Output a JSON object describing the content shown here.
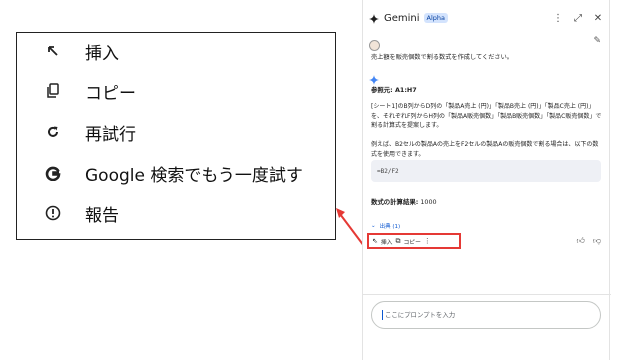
{
  "callout_menu": {
    "items": [
      {
        "icon": "insert-arrow-icon",
        "label": "挿入"
      },
      {
        "icon": "copy-icon",
        "label": "コピー"
      },
      {
        "icon": "retry-icon",
        "label": "再試行"
      },
      {
        "icon": "google-g-icon",
        "label": "Google  検索でもう一度試す"
      },
      {
        "icon": "report-icon",
        "label": "報告"
      }
    ]
  },
  "panel": {
    "brand": "Gemini",
    "badge": "Alpha",
    "prompt": "売上額を販売個数で割る数式を作成してください。",
    "reference": "参照元: A1:H7",
    "paragraph1": "[シート1]のB列からD列の「製品A売上 (円)」「製品B売上 (円)」「製品C売上 (円)」を、それぞれF列からH列の「製品A販売個数」「製品B販売個数」「製品C販売個数」で割る計算式を提案します。",
    "paragraph2": "例えば、B2セルの製品Aの売上をF2セルの製品Aの販売個数で割る場合は、以下の数式を使用できます。",
    "formula": "=B2/F2",
    "result_label": "数式の計算結果:",
    "result_value": "1000",
    "sources": "出典 (1)",
    "actions": {
      "insert": "挿入",
      "copy": "コピー"
    },
    "input_placeholder": "ここにプロンプトを入力"
  },
  "colors": {
    "accent": "#0b57d0",
    "highlight": "#e53935"
  }
}
